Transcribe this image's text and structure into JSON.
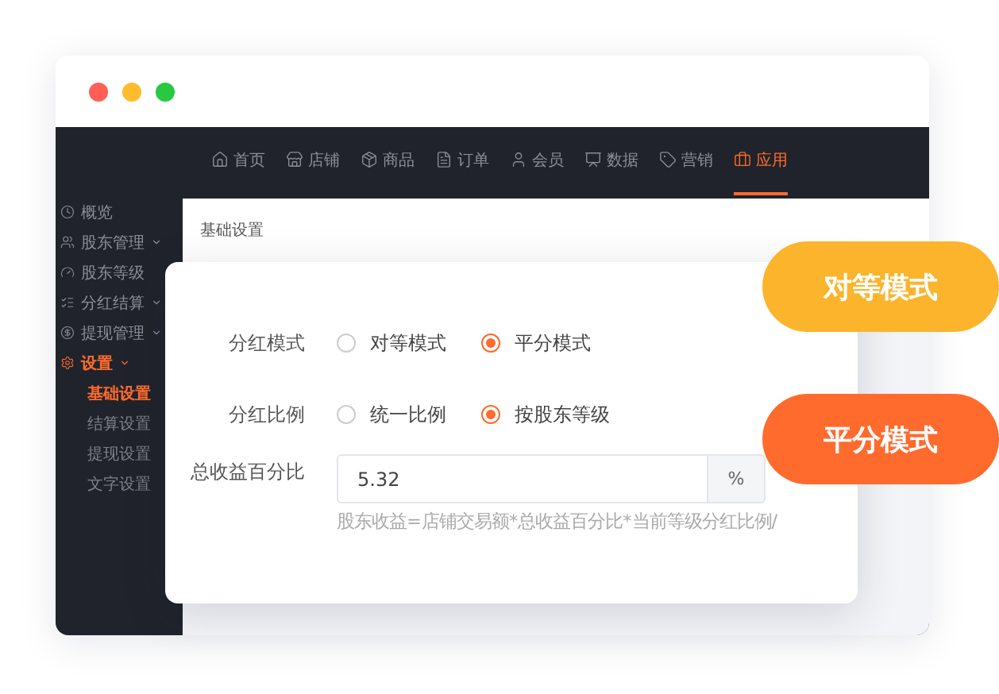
{
  "nav": [
    {
      "label": "首页",
      "selected": false
    },
    {
      "label": "店铺",
      "selected": false
    },
    {
      "label": "商品",
      "selected": false
    },
    {
      "label": "订单",
      "selected": false
    },
    {
      "label": "会员",
      "selected": false
    },
    {
      "label": "数据",
      "selected": false
    },
    {
      "label": "营销",
      "selected": false
    },
    {
      "label": "应用",
      "selected": true
    }
  ],
  "sidebar": {
    "items": [
      {
        "label": "概览",
        "selected": false,
        "expandable": false
      },
      {
        "label": "股东管理",
        "selected": false,
        "expandable": true
      },
      {
        "label": "股东等级",
        "selected": false,
        "expandable": false
      },
      {
        "label": "分红结算",
        "selected": false,
        "expandable": true
      },
      {
        "label": "提现管理",
        "selected": false,
        "expandable": true
      },
      {
        "label": "设置",
        "selected": true,
        "expandable": true,
        "children": [
          {
            "label": "基础设置",
            "selected": true
          },
          {
            "label": "结算设置",
            "selected": false
          },
          {
            "label": "提现设置",
            "selected": false
          },
          {
            "label": "文字设置",
            "selected": false
          }
        ]
      }
    ]
  },
  "page_title": "基础设置",
  "form": [
    {
      "kind": "radio",
      "label": "分红模式",
      "options": [
        {
          "label": "对等模式",
          "selected": false
        },
        {
          "label": "平分模式",
          "selected": true
        }
      ]
    },
    {
      "kind": "radio",
      "label": "分红比例",
      "options": [
        {
          "label": "统一比例",
          "selected": false
        },
        {
          "label": "按股东等级",
          "selected": true
        }
      ]
    },
    {
      "kind": "input",
      "label": "总收益百分比",
      "value": "5.32",
      "unit": "%",
      "hint": "股东收益=店铺交易额*总收益百分比*当前等级分红比例/"
    }
  ],
  "badges": [
    {
      "label": "对等模式",
      "color": "#fbb42c"
    },
    {
      "label": "平分模式",
      "color": "#ff6b2d"
    }
  ]
}
